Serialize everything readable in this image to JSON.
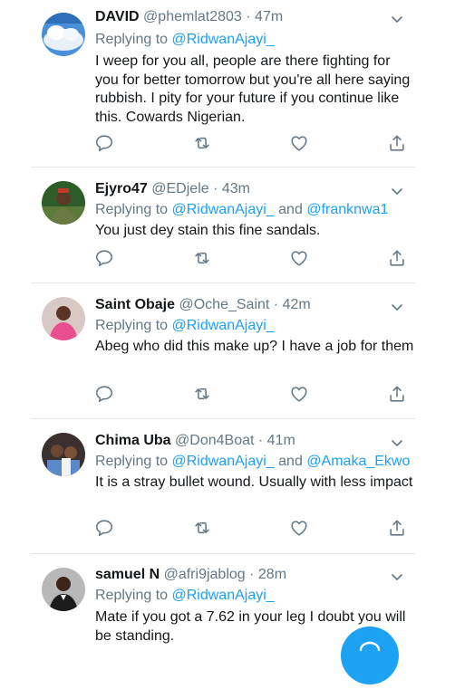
{
  "tweets": [
    {
      "name": "DAVID",
      "handle": "@phemlat2803",
      "time": "47m",
      "replying_prefix": "Replying to",
      "mention1": "@RidwanAjayi_",
      "joiner": "",
      "mention2": "",
      "text": "I weep for you all, people are there fighting for you for better tomorrow but you're all here saying rubbish. I pity for your future if you continue like this. Cowards Nigerian."
    },
    {
      "name": "Ejyro47",
      "handle": "@EDjele",
      "time": "43m",
      "replying_prefix": "Replying to",
      "mention1": "@RidwanAjayi_",
      "joiner": "and",
      "mention2": "@franknwa1",
      "text": "You just dey stain this fine sandals."
    },
    {
      "name": "Saint Obaje",
      "handle": "@Oche_Saint",
      "time": "42m",
      "replying_prefix": "Replying to",
      "mention1": "@RidwanAjayi_",
      "joiner": "",
      "mention2": "",
      "text": "Abeg who did this make up? I have a job for them"
    },
    {
      "name": "Chima Uba",
      "handle": "@Don4Boat",
      "time": "41m",
      "replying_prefix": "Replying to",
      "mention1": "@RidwanAjayi_",
      "joiner": "and",
      "mention2": "@Amaka_Ekwo",
      "text": "It is a stray bullet wound. Usually with less impact"
    },
    {
      "name": "samuel N",
      "handle": "@afri9jablog",
      "time": "28m",
      "replying_prefix": "Replying to",
      "mention1": "@RidwanAjayi_",
      "joiner": "",
      "mention2": "",
      "text": "Mate if you got a 7.62 in your leg I doubt you will be standing."
    }
  ],
  "separator": "·",
  "icons": {
    "reply": "reply-icon",
    "retweet": "retweet-icon",
    "like": "like-icon",
    "share": "share-icon",
    "menu": "chevron-down-icon",
    "compose": "compose-icon"
  },
  "colors": {
    "accent": "#1da1f2",
    "secondary_text": "#657786",
    "primary_text": "#14171a",
    "divider": "#e1e8ed"
  }
}
